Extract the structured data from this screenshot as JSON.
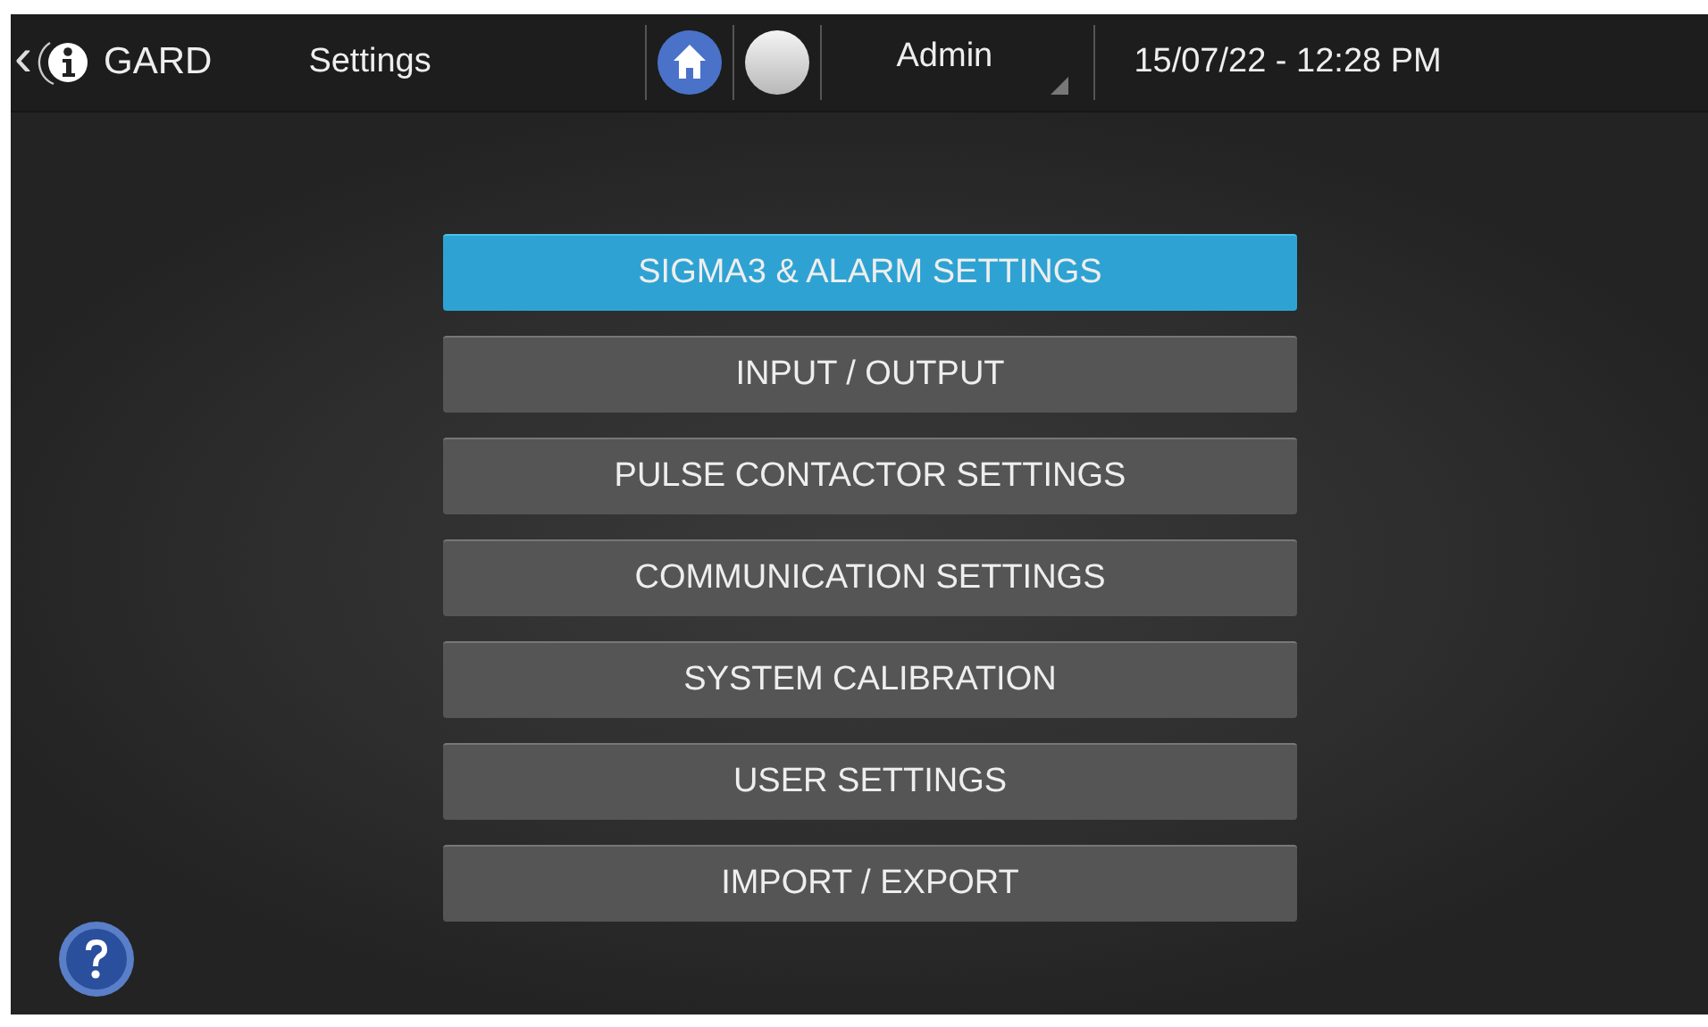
{
  "header": {
    "back": "‹",
    "brand": "GARD",
    "title": "Settings",
    "user": "Admin",
    "datetime": "15/07/22 - 12:28 PM"
  },
  "menu": [
    {
      "label": "SIGMA3 & ALARM SETTINGS",
      "selected": true
    },
    {
      "label": "INPUT / OUTPUT",
      "selected": false
    },
    {
      "label": "PULSE CONTACTOR SETTINGS",
      "selected": false
    },
    {
      "label": "COMMUNICATION SETTINGS",
      "selected": false
    },
    {
      "label": "SYSTEM CALIBRATION",
      "selected": false
    },
    {
      "label": "USER SETTINGS",
      "selected": false
    },
    {
      "label": "IMPORT / EXPORT",
      "selected": false
    }
  ]
}
